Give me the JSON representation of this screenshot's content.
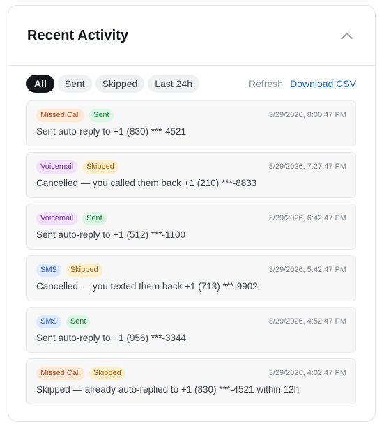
{
  "header": {
    "title": "Recent Activity"
  },
  "filters": {
    "all": "All",
    "sent": "Sent",
    "skipped": "Skipped",
    "last24": "Last 24h"
  },
  "actions": {
    "refresh": "Refresh",
    "download": "Download CSV"
  },
  "items": [
    {
      "type": "Missed Call",
      "status": "Sent",
      "time": "3/29/2026, 8:00:47 PM",
      "text": "Sent auto-reply to +1 (830) ***-4521"
    },
    {
      "type": "Voicemail",
      "status": "Skipped",
      "time": "3/29/2026, 7:27:47 PM",
      "text": "Cancelled — you called them back +1 (210) ***-8833"
    },
    {
      "type": "Voicemail",
      "status": "Sent",
      "time": "3/29/2026, 6:42:47 PM",
      "text": "Sent auto-reply to +1 (512) ***-1100"
    },
    {
      "type": "SMS",
      "status": "Skipped",
      "time": "3/29/2026, 5:42:47 PM",
      "text": "Cancelled — you texted them back +1 (713) ***-9902"
    },
    {
      "type": "SMS",
      "status": "Sent",
      "time": "3/29/2026, 4:52:47 PM",
      "text": "Sent auto-reply to +1 (956) ***-3344"
    },
    {
      "type": "Missed Call",
      "status": "Skipped",
      "time": "3/29/2026, 4:02:47 PM",
      "text": "Skipped — already auto-replied to +1 (830) ***-4521 within 12h"
    }
  ],
  "colors": {
    "active_chip": "#15171a",
    "link": "#1b66d6",
    "missed_call": "#fde9d6",
    "voicemail": "#f1e1fb",
    "sms": "#dde9fd",
    "sent": "#dcf6e5",
    "skipped": "#fdefcb"
  },
  "icons": {
    "collapse": "chevron-up-icon"
  }
}
